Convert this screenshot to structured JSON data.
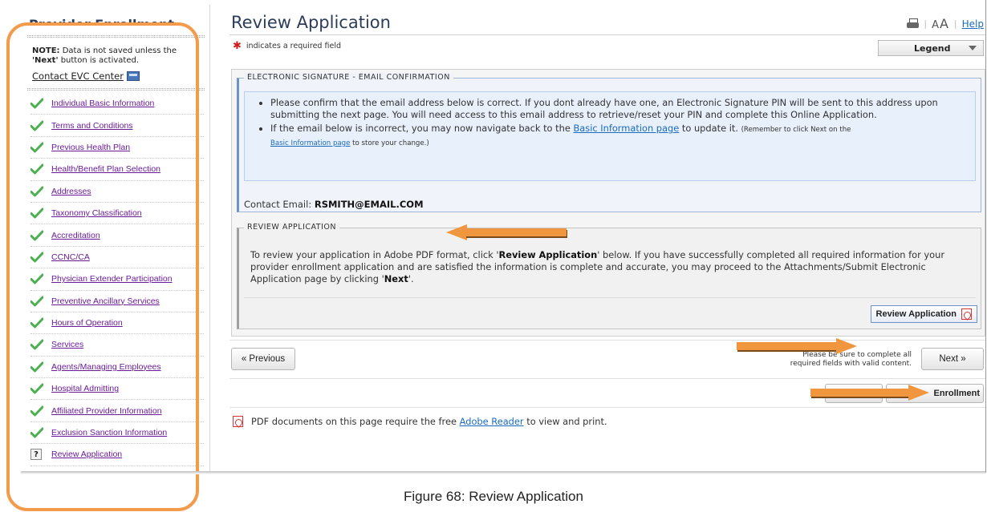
{
  "sidebar": {
    "title": "Provider Enrollment",
    "note_label": "NOTE:",
    "note_text": " Data is not saved unless the ",
    "note_next": "'Next'",
    "note_tail": " button is activated.",
    "contact_label": "Contact EVC Center",
    "items": [
      {
        "label": "Individual Basic Information",
        "status": "complete"
      },
      {
        "label": "Terms and Conditions",
        "status": "complete"
      },
      {
        "label": "Previous Health Plan",
        "status": "complete"
      },
      {
        "label": "Health/Benefit Plan Selection",
        "status": "complete"
      },
      {
        "label": "Addresses",
        "status": "complete"
      },
      {
        "label": "Taxonomy Classification",
        "status": "complete"
      },
      {
        "label": "Accreditation",
        "status": "complete"
      },
      {
        "label": "CCNC/CA",
        "status": "complete"
      },
      {
        "label": "Physician Extender Participation",
        "status": "complete"
      },
      {
        "label": "Preventive Ancillary Services",
        "status": "complete"
      },
      {
        "label": "Hours of Operation",
        "status": "complete"
      },
      {
        "label": "Services",
        "status": "complete"
      },
      {
        "label": "Agents/Managing Employees",
        "status": "complete"
      },
      {
        "label": "Hospital Admitting",
        "status": "complete"
      },
      {
        "label": "Affiliated Provider Information",
        "status": "complete"
      },
      {
        "label": "Exclusion Sanction Information",
        "status": "complete"
      },
      {
        "label": "Review Application",
        "status": "current"
      }
    ]
  },
  "header": {
    "title": "Review Application",
    "text_size_small": "A",
    "text_size_big": "A",
    "help_label": "Help",
    "required_note": "indicates a required field",
    "legend_label": "Legend"
  },
  "esig": {
    "legend": "Electronic Signature - Email Confirmation",
    "bullet1": "Please confirm that the email address below is correct. If you dont already have one, an Electronic Signature PIN will be sent to this address upon submitting the next page. You will need access to this email address to retrieve/reset your PIN and complete this Online Application.",
    "bullet2_pre": "If the email below is incorrect, you may now navigate back to the ",
    "bullet2_link": "Basic Information page",
    "bullet2_post": " to update it. ",
    "bullet2_small_pre": "(Remember to click Next on the ",
    "bullet2_small_link": "Basic Information page",
    "bullet2_small_post": " to store your change.)",
    "contact_email_label": "Contact Email: ",
    "contact_email_value": "RSMITH@EMAIL.COM"
  },
  "review": {
    "legend": "Review Application",
    "text_pre": "To review your application in Adobe PDF format, click '",
    "text_bold1": "Review Application",
    "text_mid": "' below. If you have successfully completed all required information for your provider enrollment application and are satisfied the information is complete and accurate, you may proceed to the Attachments/Submit Electronic Application page by clicking '",
    "text_bold2": "Next",
    "text_post": "'.",
    "button_label": "Review Application"
  },
  "nav": {
    "previous_label": "« Previous",
    "validation_line1": "Please be sure to complete all",
    "validation_line2": "required fields with valid content.",
    "next_label": "Next »",
    "enrollment_label": "Enrollment"
  },
  "footer": {
    "pdf_note_pre": "PDF documents on this page require the free ",
    "pdf_note_link": "Adobe Reader",
    "pdf_note_post": " to view and print."
  },
  "caption": "Figure 68: Review Application",
  "colors": {
    "annotation": "#f0963f",
    "title": "#2c3d5a",
    "link": "#1a6bbf",
    "nav_link": "#6a1b9a",
    "check": "#4caf50"
  },
  "icons": [
    "print-icon",
    "text-size-icon",
    "checkmark-icon",
    "question-icon",
    "pdf-icon",
    "contact-card-icon",
    "chevron-down-icon"
  ]
}
